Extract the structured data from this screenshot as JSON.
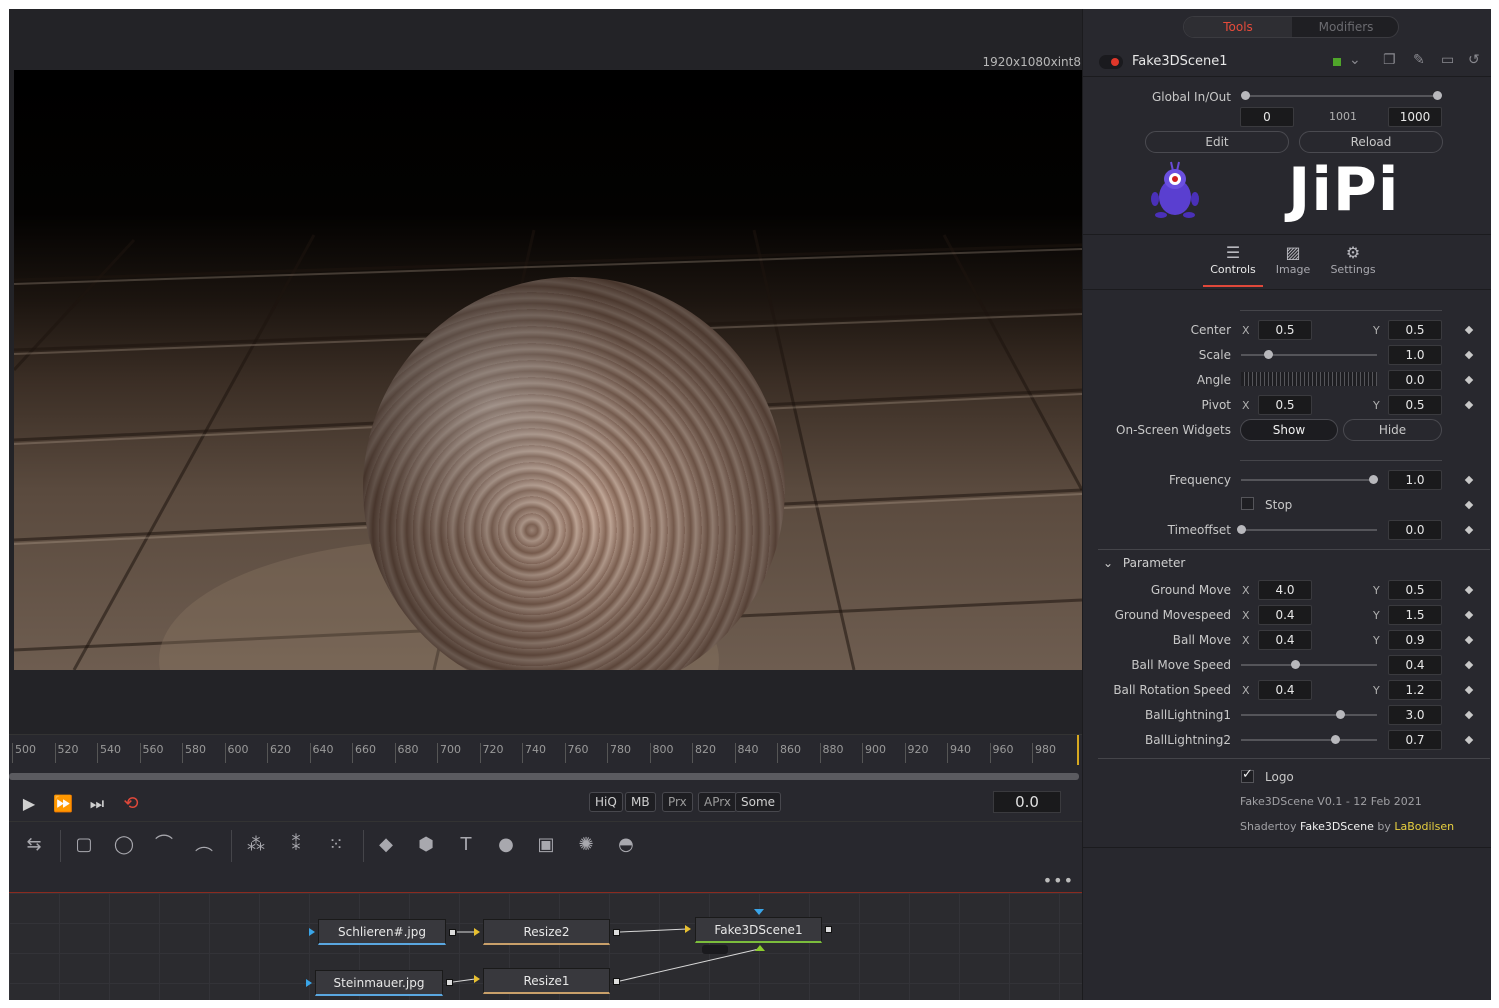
{
  "viewer": {
    "resolution": "1920x1080xint8"
  },
  "timeline": {
    "ticks": [
      "500",
      "520",
      "540",
      "560",
      "580",
      "600",
      "620",
      "640",
      "660",
      "680",
      "700",
      "720",
      "740",
      "760",
      "780",
      "800",
      "820",
      "840",
      "860",
      "880",
      "900",
      "920",
      "940",
      "960",
      "980"
    ],
    "current_time": "0.0"
  },
  "transport": {
    "play_icon": "play-icon",
    "fast_forward_icon": "fast-forward-icon",
    "skip_end_icon": "skip-to-end-icon",
    "loop_icon": "loop-icon",
    "quality_buttons": [
      "HiQ",
      "MB",
      "Prx",
      "APrx",
      "Some"
    ]
  },
  "tools": [
    "background-tool-icon",
    "rectangle-tool-icon",
    "ellipse-tool-icon",
    "polygon-tool-icon",
    "bspline-tool-icon",
    "particle-emitter-icon",
    "particle-render-icon",
    "particle-style-icon",
    "shape3d-icon",
    "merge3d-icon",
    "text3d-icon",
    "camera3d-icon",
    "renderer3d-icon",
    "light3d-icon",
    "image-plane-icon"
  ],
  "flow": {
    "nodes": {
      "loader1": "Schlieren#.jpg",
      "loader2": "Steinmauer.jpg",
      "resize2": "Resize2",
      "resize1": "Resize1",
      "fuse": "Fake3DScene1"
    }
  },
  "inspector": {
    "tabs": {
      "tools": "Tools",
      "modifiers": "Modifiers"
    },
    "tool_name": "Fake3DScene1",
    "global_inout": {
      "label": "Global In/Out",
      "start": "0",
      "mid": "1001",
      "end": "1000"
    },
    "edit_button": "Edit",
    "reload_button": "Reload",
    "logo_text": "JiPi",
    "page_tabs": {
      "controls": "Controls",
      "image": "Image",
      "settings": "Settings"
    },
    "controls": {
      "center": {
        "label": "Center",
        "x": "0.5",
        "y": "0.5"
      },
      "scale": {
        "label": "Scale",
        "value": "1.0",
        "fraction": 0.2
      },
      "angle": {
        "label": "Angle",
        "value": "0.0"
      },
      "pivot": {
        "label": "Pivot",
        "x": "0.5",
        "y": "0.5"
      },
      "widgets": {
        "label": "On-Screen Widgets",
        "show": "Show",
        "hide": "Hide"
      },
      "frequency": {
        "label": "Frequency",
        "value": "1.0",
        "fraction": 0.97
      },
      "stop": {
        "label": "Stop"
      },
      "timeoffset": {
        "label": "Timeoffset",
        "value": "0.0",
        "fraction": 0.0
      }
    },
    "parameter": {
      "title": "Parameter",
      "ground_move": {
        "label": "Ground Move",
        "x": "4.0",
        "y": "0.5"
      },
      "ground_movespeed": {
        "label": "Ground Movespeed",
        "x": "0.4",
        "y": "1.5"
      },
      "ball_move": {
        "label": "Ball Move",
        "x": "0.4",
        "y": "0.9"
      },
      "ball_move_speed": {
        "label": "Ball Move Speed",
        "value": "0.4",
        "fraction": 0.4
      },
      "ball_rotation_speed": {
        "label": "Ball Rotation Speed",
        "x": "0.4",
        "y": "1.2"
      },
      "ball_lightning1": {
        "label": "BallLightning1",
        "value": "3.0",
        "fraction": 0.73
      },
      "ball_lightning2": {
        "label": "BallLightning2",
        "value": "0.7",
        "fraction": 0.69
      }
    },
    "logo_checkbox": "Logo",
    "version": "Fake3DScene V0.1 - 12 Feb 2021",
    "credit": {
      "prefix": "Shadertoy",
      "name": "Fake3DScene",
      "by": "by",
      "author": "LaBodilsen"
    },
    "axis_x": "X",
    "axis_y": "Y"
  }
}
